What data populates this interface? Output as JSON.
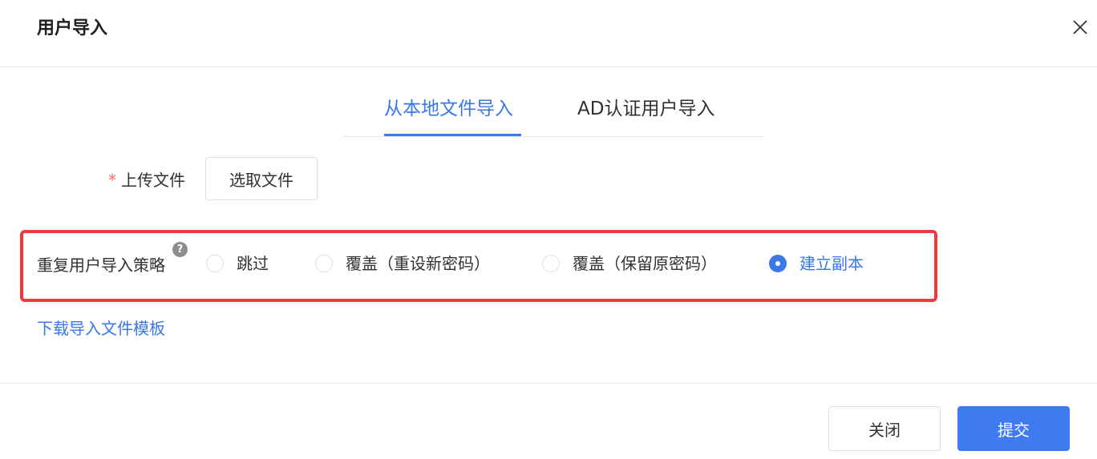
{
  "dialog": {
    "title": "用户导入"
  },
  "tabs": {
    "items": [
      {
        "label": "从本地文件导入",
        "active": true
      },
      {
        "label": "AD认证用户导入",
        "active": false
      }
    ]
  },
  "upload": {
    "required_mark": "*",
    "label": "上传文件",
    "button_label": "选取文件"
  },
  "strategy": {
    "label": "重复用户导入策略",
    "help_glyph": "?",
    "options": [
      {
        "label": "跳过",
        "checked": false
      },
      {
        "label": "覆盖（重设新密码）",
        "checked": false
      },
      {
        "label": "覆盖（保留原密码）",
        "checked": false
      },
      {
        "label": "建立副本",
        "checked": true
      }
    ],
    "highlight_color": "#f0393d"
  },
  "download_template_link": "下载导入文件模板",
  "footer": {
    "close_label": "关闭",
    "submit_label": "提交"
  },
  "colors": {
    "accent": "#3a78e8",
    "primary_button": "#3f7bf0",
    "required": "#f56c6c"
  },
  "icons": {
    "close": "close-icon",
    "help": "question-circle-icon"
  }
}
